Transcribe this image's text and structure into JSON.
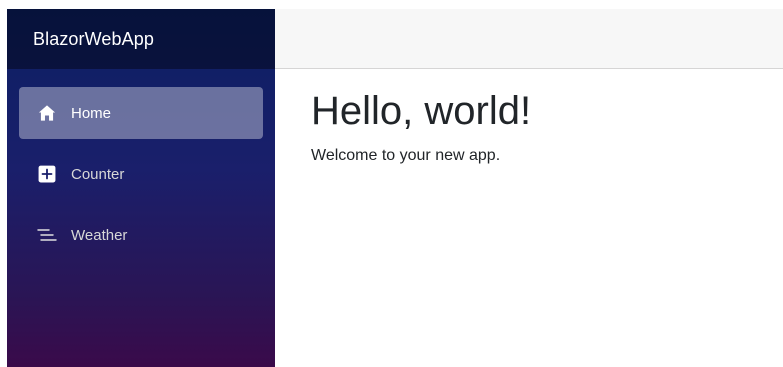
{
  "sidebar": {
    "brand": "BlazorWebApp",
    "items": [
      {
        "label": "Home",
        "icon": "house-icon",
        "active": true
      },
      {
        "label": "Counter",
        "icon": "plus-square-icon",
        "active": false
      },
      {
        "label": "Weather",
        "icon": "list-lines-icon",
        "active": false
      }
    ]
  },
  "main": {
    "title": "Hello, world!",
    "text": "Welcome to your new app."
  }
}
